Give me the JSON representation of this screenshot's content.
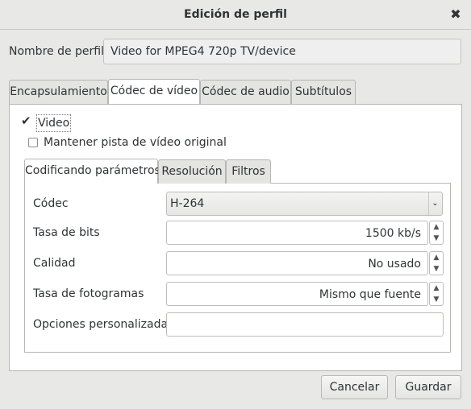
{
  "window": {
    "title": "Edición de perfil",
    "close_glyph": "✖"
  },
  "profile": {
    "name_label": "Nombre de perfil",
    "name_value": "Video for MPEG4 720p TV/device"
  },
  "tabs": [
    {
      "label": "Encapsulamiento",
      "active": false
    },
    {
      "label": "Códec de vídeo",
      "active": true
    },
    {
      "label": "Códec de audio",
      "active": false
    },
    {
      "label": "Subtítulos",
      "active": false
    }
  ],
  "video": {
    "enable_label": "Video",
    "enable_checked": true,
    "keep_track_label": "Mantener pista de vídeo original",
    "keep_track_checked": false
  },
  "subtabs": [
    {
      "label": "Codificando parámetros",
      "active": true
    },
    {
      "label": "Resolución",
      "active": false
    },
    {
      "label": "Filtros",
      "active": false
    }
  ],
  "params": {
    "codec_label": "Códec",
    "codec_value": "H-264",
    "bitrate_label": "Tasa de bits",
    "bitrate_value": "1500 kb/s",
    "quality_label": "Calidad",
    "quality_value": "No usado",
    "framerate_label": "Tasa de fotogramas",
    "framerate_value": "Mismo que fuente",
    "custom_label": "Opciones personalizadas",
    "custom_value": ""
  },
  "icons": {
    "close": "close-icon",
    "check": "check-icon",
    "combo_arrow": "chevron-down-icon",
    "spin_up": "chevron-up-icon",
    "spin_down": "chevron-down-icon"
  },
  "buttons": {
    "cancel": "Cancelar",
    "save": "Guardar"
  }
}
